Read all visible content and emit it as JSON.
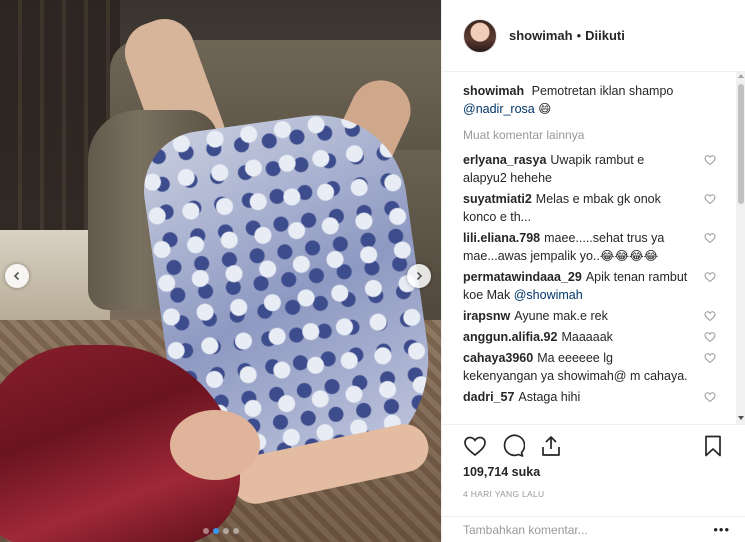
{
  "post": {
    "username": "showimah",
    "separator": "•",
    "follow_status": "Diikuti",
    "caption_text": "Pemotretan iklan shampo",
    "caption_mention": "@nadir_rosa",
    "caption_emoji": "😄",
    "load_more": "Muat komentar lainnya",
    "likes": "109,714 suka",
    "timestamp": "4 HARI YANG LALU"
  },
  "comments": [
    {
      "user": "erlyana_rasya",
      "text": "Uwapik rambut e alapyu2 hehehe"
    },
    {
      "user": "suyatmiati2",
      "text": "Melas e mbak gk onok konco e th..."
    },
    {
      "user": "lili.eliana.798",
      "text": "maee.....sehat trus ya mae...awas jempalik yo..😂😂😂😂"
    },
    {
      "user": "permatawindaaa_29",
      "text": "Apik tenan rambut koe Mak",
      "mention": "@showimah"
    },
    {
      "user": "irapsnw",
      "text": "Ayune mak.e rek"
    },
    {
      "user": "anggun.alifia.92",
      "text": "Maaaaak"
    },
    {
      "user": "cahaya3960",
      "text": "Ma eeeeee lg kekenyangan ya showimah@ m cahaya."
    },
    {
      "user": "dadri_57",
      "text": "Astaga hihi"
    }
  ],
  "add_comment": {
    "placeholder": "Tambahkan komentar...",
    "options_label": "•••"
  },
  "carousel": {
    "slide_count": 4,
    "active_index": 1
  },
  "icons": {
    "like": "heart-icon",
    "comment": "comment-icon",
    "share": "share-icon",
    "save": "bookmark-icon",
    "prev": "chevron-left-icon",
    "next": "chevron-right-icon"
  },
  "colors": {
    "text": "#262626",
    "muted": "#999999",
    "link": "#003569",
    "active_dot": "#3897f0",
    "border": "#efefef"
  }
}
